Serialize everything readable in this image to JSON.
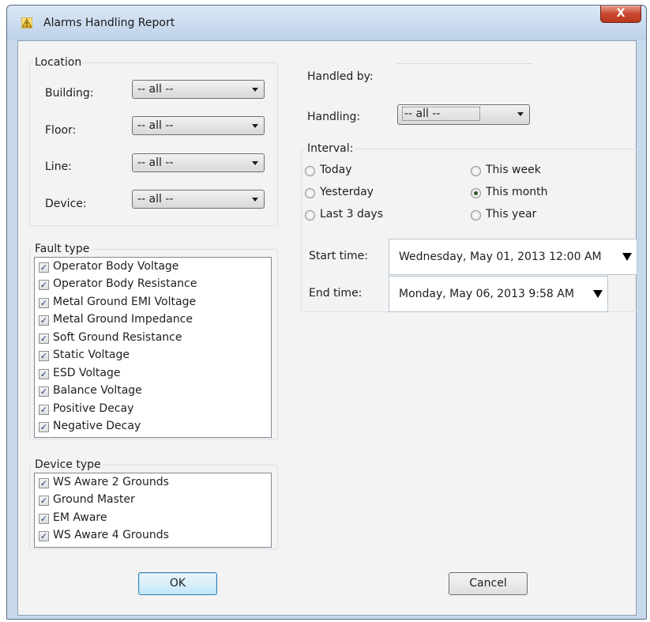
{
  "window": {
    "title": "Alarms Handling Report",
    "close_label": "X"
  },
  "location": {
    "legend": "Location",
    "building_label": "Building:",
    "building_value": "-- all --",
    "floor_label": "Floor:",
    "floor_value": "-- all --",
    "line_label": "Line:",
    "line_value": "-- all --",
    "device_label": "Device:",
    "device_value": "-- all --"
  },
  "handled_by": {
    "label": "Handled by:",
    "value": ""
  },
  "handling": {
    "label": "Handling:",
    "value": "-- all --"
  },
  "interval": {
    "legend": "Interval:",
    "options": [
      {
        "label": "Today",
        "selected": false
      },
      {
        "label": "Yesterday",
        "selected": false
      },
      {
        "label": "Last 3 days",
        "selected": false
      },
      {
        "label": "This week",
        "selected": false
      },
      {
        "label": "This month",
        "selected": true
      },
      {
        "label": "This year",
        "selected": false
      }
    ],
    "start_label": "Start time:",
    "start_value": "Wednesday, May 01, 2013 12:00 AM",
    "end_label": "End time:",
    "end_value": "Monday, May 06, 2013 9:58 AM"
  },
  "fault_type": {
    "legend": "Fault type",
    "items": [
      {
        "label": "Operator Body Voltage",
        "checked": true
      },
      {
        "label": "Operator Body Resistance",
        "checked": true
      },
      {
        "label": "Metal Ground EMI Voltage",
        "checked": true
      },
      {
        "label": "Metal Ground Impedance",
        "checked": true
      },
      {
        "label": "Soft Ground Resistance",
        "checked": true
      },
      {
        "label": "Static Voltage",
        "checked": true
      },
      {
        "label": "ESD Voltage",
        "checked": true
      },
      {
        "label": "Balance Voltage",
        "checked": true
      },
      {
        "label": "Positive Decay",
        "checked": true
      },
      {
        "label": "Negative Decay",
        "checked": true
      }
    ]
  },
  "device_type": {
    "legend": "Device type",
    "items": [
      {
        "label": "WS Aware 2 Grounds",
        "checked": true
      },
      {
        "label": "Ground Master",
        "checked": true
      },
      {
        "label": "EM Aware",
        "checked": true
      },
      {
        "label": "WS Aware 4 Grounds",
        "checked": true
      }
    ]
  },
  "buttons": {
    "ok": "OK",
    "cancel": "Cancel"
  }
}
